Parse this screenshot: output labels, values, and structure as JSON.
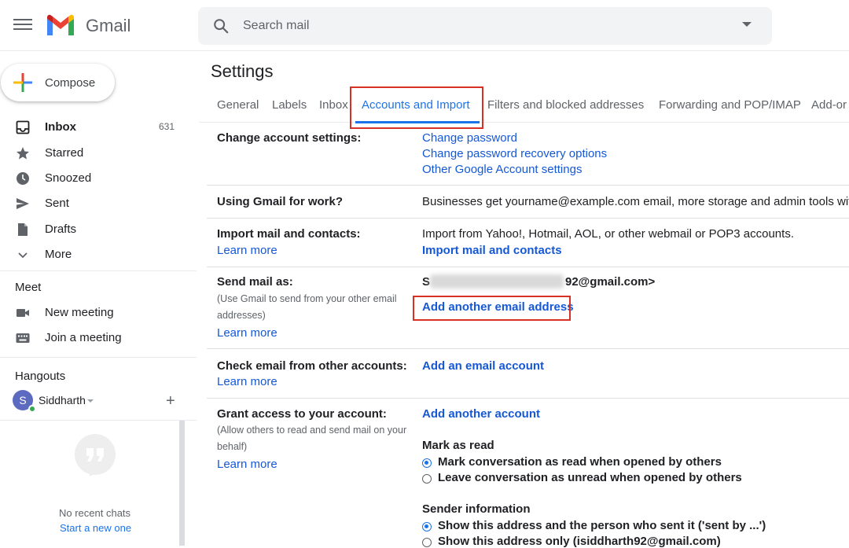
{
  "header": {
    "app_name": "Gmail",
    "search_placeholder": "Search mail"
  },
  "sidebar": {
    "compose_label": "Compose",
    "nav": [
      {
        "label": "Inbox",
        "count": "631",
        "icon": "inbox-icon"
      },
      {
        "label": "Starred",
        "icon": "star-icon"
      },
      {
        "label": "Snoozed",
        "icon": "clock-icon"
      },
      {
        "label": "Sent",
        "icon": "send-icon"
      },
      {
        "label": "Drafts",
        "icon": "draft-icon"
      },
      {
        "label": "More",
        "icon": "chevron-down-icon"
      }
    ],
    "meet": {
      "title": "Meet",
      "items": [
        {
          "label": "New meeting",
          "icon": "video-camera-icon"
        },
        {
          "label": "Join a meeting",
          "icon": "keyboard-icon"
        }
      ]
    },
    "hangouts": {
      "title": "Hangouts",
      "user_initial": "S",
      "user_name": "Siddharth",
      "add_label": "+",
      "no_chats": "No recent chats",
      "start_new": "Start a new one"
    }
  },
  "settings": {
    "title": "Settings",
    "tabs": [
      "General",
      "Labels",
      "Inbox",
      "Accounts and Import",
      "Filters and blocked addresses",
      "Forwarding and POP/IMAP",
      "Add-or"
    ],
    "active_tab_index": 3,
    "rows": {
      "change_account": {
        "label": "Change account settings:",
        "links": [
          "Change password",
          "Change password recovery options",
          "Other Google Account settings"
        ]
      },
      "gmail_work": {
        "label": "Using Gmail for work?",
        "text": "Businesses get yourname@example.com email, more storage and admin tools with G"
      },
      "import": {
        "label": "Import mail and contacts:",
        "learn_more": "Learn more",
        "text": "Import from Yahoo!, Hotmail, AOL, or other webmail or POP3 accounts.",
        "action": "Import mail and contacts"
      },
      "send_as": {
        "label": "Send mail as:",
        "sub_line1": "(Use Gmail to send from your other email",
        "sub_line2": "addresses)",
        "learn_more": "Learn more",
        "email_prefix": "S",
        "email_suffix": "92@gmail.com>",
        "action": "Add another email address"
      },
      "check_email": {
        "label": "Check email from other accounts:",
        "learn_more": "Learn more",
        "action": "Add an email account"
      },
      "grant_access": {
        "label": "Grant access to your account:",
        "sub_line1": "(Allow others to read and send mail on your",
        "sub_line2": "behalf)",
        "learn_more": "Learn more",
        "action": "Add another account",
        "mark_as_read_title": "Mark as read",
        "mark_options": [
          "Mark conversation as read when opened by others",
          "Leave conversation as unread when opened by others"
        ],
        "mark_selected": 0,
        "sender_info_title": "Sender information",
        "sender_options": [
          "Show this address and the person who sent it ('sent by ...')",
          "Show this address only (isiddharth92@gmail.com)"
        ],
        "sender_selected": 0
      }
    }
  },
  "colors": {
    "accent": "#1a73e8",
    "link": "#1558d6",
    "highlight_box": "#d93025"
  }
}
